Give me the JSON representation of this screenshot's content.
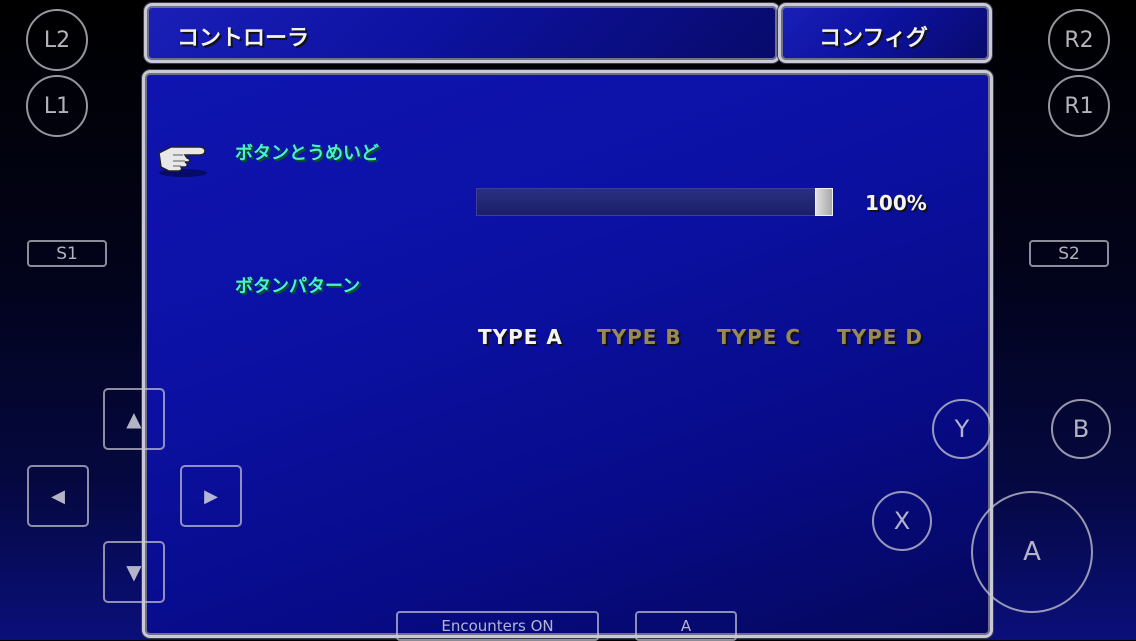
{
  "header": {
    "title": "コントローラ",
    "tab": "コンフィグ"
  },
  "menu": {
    "items": [
      {
        "label": "ボタンとうめいど"
      },
      {
        "label": "ボタンパターン"
      }
    ],
    "opacity": {
      "value_text": "100%",
      "fraction": 1.0
    },
    "patterns": [
      "TYPE A",
      "TYPE B",
      "TYPE C",
      "TYPE D"
    ],
    "selected_pattern": "TYPE A"
  },
  "controls": {
    "l2": "L2",
    "l1": "L1",
    "r2": "R2",
    "r1": "R1",
    "s1": "S1",
    "s2": "S2",
    "y": "Y",
    "b": "B",
    "x": "X",
    "a": "A",
    "dpad_up": "▲",
    "dpad_left": "◀",
    "dpad_right": "▶",
    "dpad_down": "▼",
    "encounters": "Encounters ON",
    "bottom_a": "A"
  },
  "colors": {
    "menu_label": "#4ff0c8",
    "selected": "#f4f4f4",
    "unselected": "#9a8a52"
  }
}
